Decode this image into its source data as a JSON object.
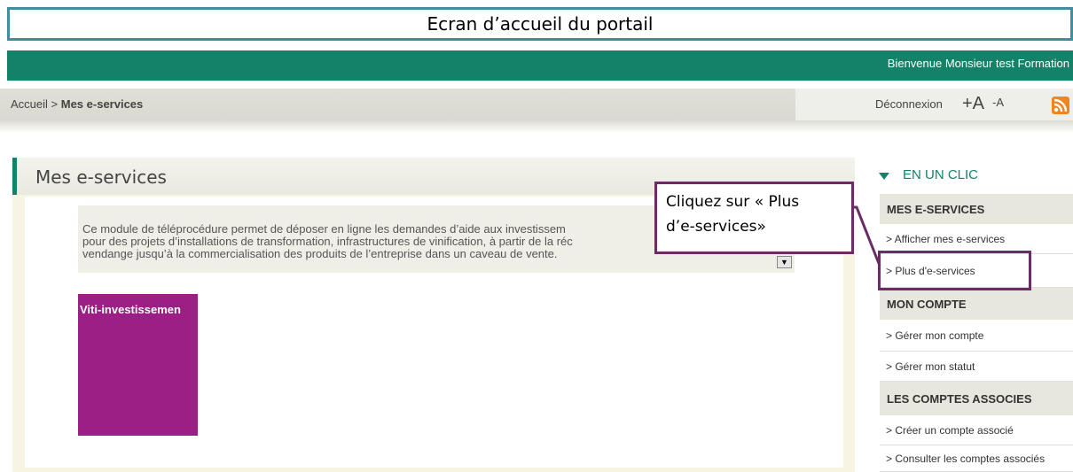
{
  "caption": "Ecran d’accueil du portail",
  "header": {
    "welcome": "Bienvenue Monsieur test Formation"
  },
  "breadcrumb": {
    "home": "Accueil",
    "separator": " > ",
    "current": "Mes e-services"
  },
  "toolbar": {
    "logout": "Déconnexion",
    "font_plus": "+A",
    "font_minus": "-A",
    "rss_icon": "rss-icon"
  },
  "main": {
    "title": "Mes e-services",
    "description": "Ce module de téléprocédure permet de déposer en ligne les demandes d’aide aux investissem pour des projets d’installations de transformation, infrastructures de vinification, à partir de la réc vendange jusqu’à la commercialisation des produits de l’entreprise dans un caveau de vente.",
    "description_lines": [
      "Ce module de téléprocédure permet de déposer en ligne les demandes d’aide aux investissem",
      "pour des projets d’installations de transformation, infrastructures de vinification, à partir de la réc",
      "vendange jusqu’à la commercialisation des produits de l’entreprise dans un caveau de vente."
    ],
    "scroll_glyph": "▼",
    "tile_label": "Viti-investissemen"
  },
  "callout": {
    "lines": [
      "Cliquez sur « Plus",
      "d’e-services»"
    ]
  },
  "sidebar": {
    "heading": "EN UN CLIC",
    "sections": [
      {
        "title": "MES E-SERVICES",
        "items": [
          "> Afficher mes e-services",
          "> Plus d'e-services"
        ]
      },
      {
        "title": "MON COMPTE",
        "items": [
          "> Gérer mon compte",
          "> Gérer mon statut"
        ]
      },
      {
        "title": "LES COMPTES ASSOCIES",
        "items": [
          "> Créer un compte associé",
          "> Consulter les comptes associés"
        ]
      }
    ]
  },
  "colors": {
    "brand_green": "#138268",
    "tile_purple": "#9b1f84",
    "callout_border": "#6b2c66",
    "caption_border": "#3e8ea0"
  }
}
